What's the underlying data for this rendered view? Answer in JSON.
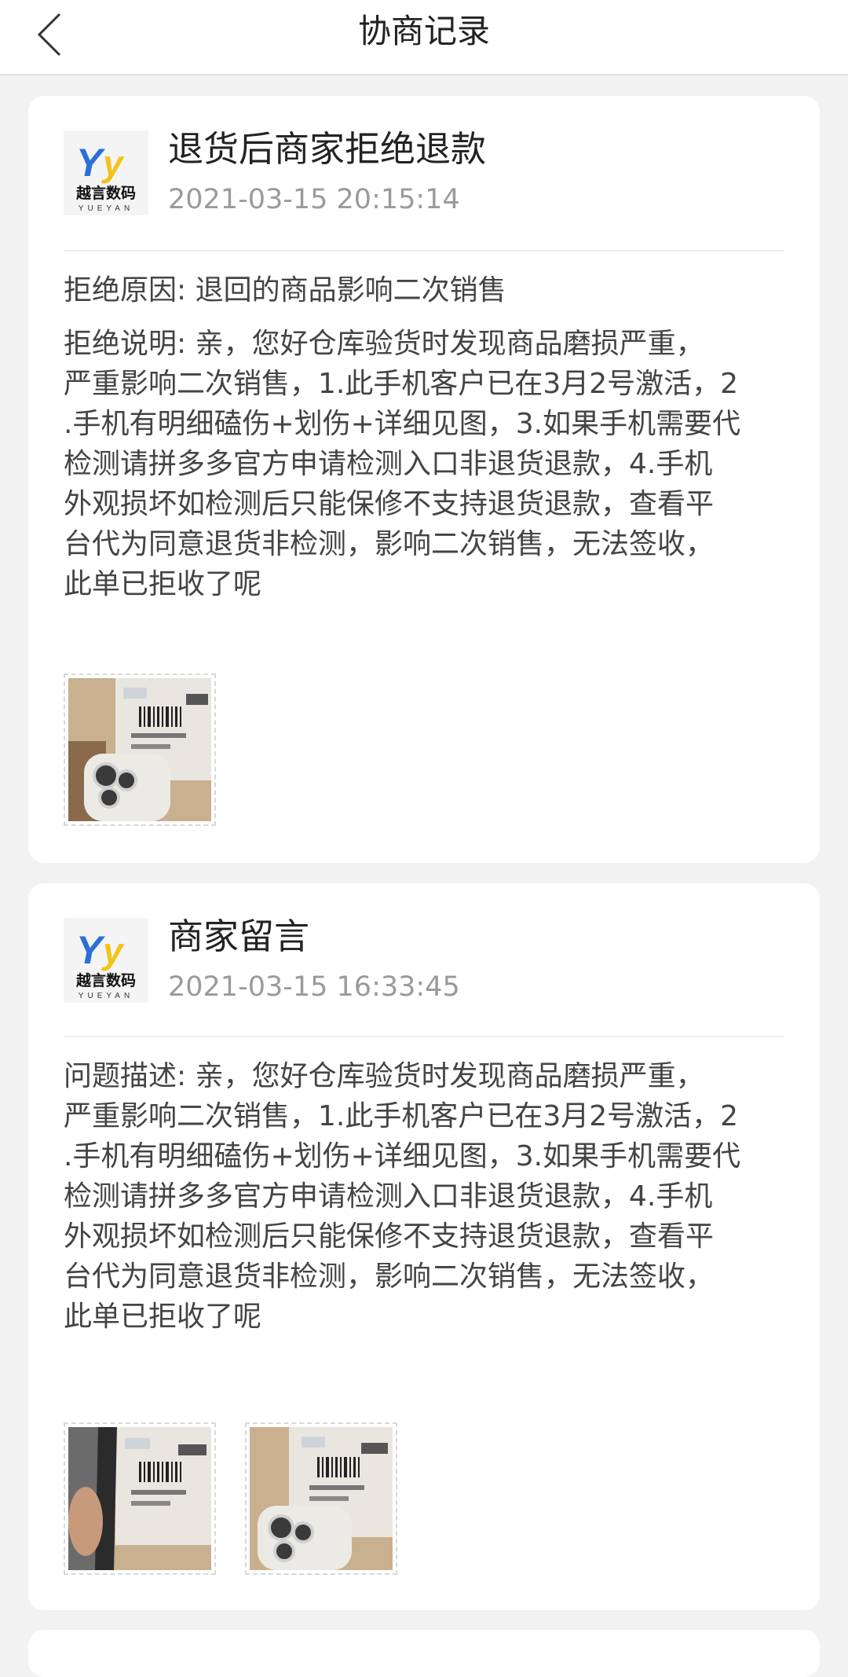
{
  "header": {
    "title": "协商记录",
    "back_icon": "chevron-left-icon"
  },
  "logo": {
    "mark": "Yy",
    "name": "越言数码",
    "sub": "YUEYAN",
    "colors": {
      "y_blue": "#2c6fd6",
      "y_yellow": "#f2c318",
      "text": "#111111"
    }
  },
  "records": [
    {
      "title": "退货后商家拒绝退款",
      "time": "2021-03-15 20:15:14",
      "reason": "拒绝原因: 退回的商品影响二次销售",
      "detail_lines": [
        "拒绝说明: 亲，您好仓库验货时发现商品磨损严重，",
        "严重影响二次销售，1.此手机客户已在3月2号激活，2",
        ".手机有明细磕伤+划伤+详细见图，3.如果手机需要代",
        "检测请拼多多官方申请检测入口非退货退款，4.手机",
        "外观损坏如检测后只能保修不支持退货退款，查看平",
        "台代为同意退货非检测，影响二次销售，无法签收，",
        "此单已拒收了呢"
      ],
      "images": [
        "photo-phone-camera-on-box"
      ]
    },
    {
      "title": "商家留言",
      "time": "2021-03-15 16:33:45",
      "detail_lines": [
        "问题描述: 亲，您好仓库验货时发现商品磨损严重，",
        "严重影响二次销售，1.此手机客户已在3月2号激活，2",
        ".手机有明细磕伤+划伤+详细见图，3.如果手机需要代",
        "检测请拼多多官方申请检测入口非退货退款，4.手机",
        "外观损坏如检测后只能保修不支持退货退款，查看平",
        "台代为同意退货非检测，影响二次销售，无法签收，",
        "此单已拒收了呢"
      ],
      "images": [
        "photo-phone-side-on-box",
        "photo-phone-camera-on-box"
      ]
    }
  ]
}
